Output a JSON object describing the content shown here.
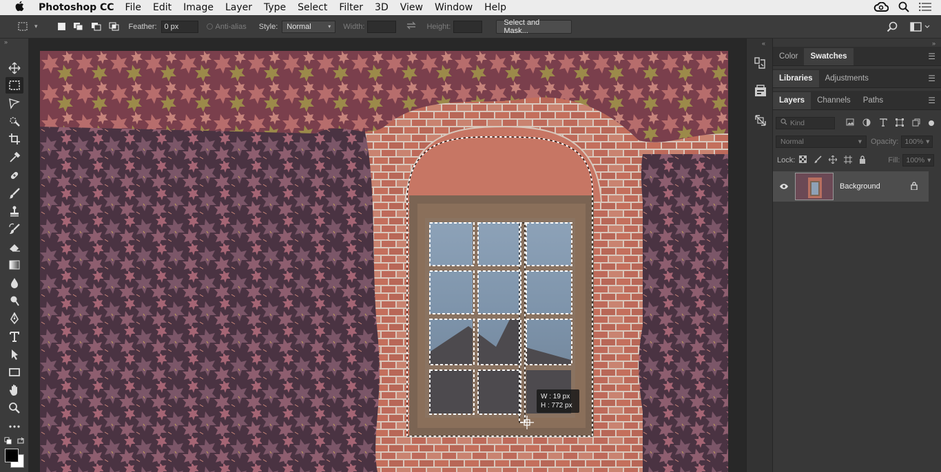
{
  "menubar": {
    "apple": "",
    "app_name": "Photoshop CC",
    "menus": [
      "File",
      "Edit",
      "Image",
      "Layer",
      "Type",
      "Select",
      "Filter",
      "3D",
      "View",
      "Window",
      "Help"
    ]
  },
  "options": {
    "feather_label": "Feather:",
    "feather_value": "0 px",
    "antialias_label": "Anti-alias",
    "style_label": "Style:",
    "style_value": "Normal",
    "width_label": "Width:",
    "height_label": "Height:",
    "select_mask_label": "Select and Mask..."
  },
  "canvas": {
    "tooltip_w": "W :  19 px",
    "tooltip_h": "H : 772 px"
  },
  "panels": {
    "group1_tabs": [
      "Color",
      "Swatches"
    ],
    "group2_tabs": [
      "Libraries",
      "Adjustments"
    ],
    "group3_tabs": [
      "Layers",
      "Channels",
      "Paths"
    ],
    "kind_placeholder": "Kind",
    "blend_mode": "Normal",
    "opacity_label": "Opacity:",
    "opacity_value": "100%",
    "lock_label": "Lock:",
    "fill_label": "Fill:",
    "fill_value": "100%",
    "layer_name": "Background"
  },
  "colors": {
    "accent_active_tab": "#3f3f3f",
    "panel_bg": "#383838",
    "foreground_color": "#000000",
    "background_color": "#ffffff"
  }
}
